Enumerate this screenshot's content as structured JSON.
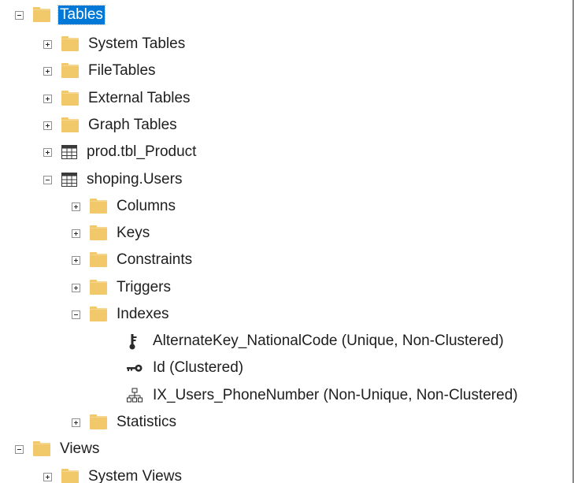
{
  "tree": {
    "top_partial_label": "",
    "nodes": [
      {
        "label": "Tables",
        "icon": "folder-icon",
        "state": "expanded",
        "selected": true
      },
      {
        "label": "System Tables",
        "icon": "folder-icon",
        "state": "collapsed"
      },
      {
        "label": "FileTables",
        "icon": "folder-icon",
        "state": "collapsed"
      },
      {
        "label": "External Tables",
        "icon": "folder-icon",
        "state": "collapsed"
      },
      {
        "label": "Graph Tables",
        "icon": "folder-icon",
        "state": "collapsed"
      },
      {
        "label": "prod.tbl_Product",
        "icon": "table-icon",
        "state": "collapsed"
      },
      {
        "label": "shoping.Users",
        "icon": "table-icon",
        "state": "expanded"
      },
      {
        "label": "Columns",
        "icon": "folder-icon",
        "state": "collapsed"
      },
      {
        "label": "Keys",
        "icon": "folder-icon",
        "state": "collapsed"
      },
      {
        "label": "Constraints",
        "icon": "folder-icon",
        "state": "collapsed"
      },
      {
        "label": "Triggers",
        "icon": "folder-icon",
        "state": "collapsed"
      },
      {
        "label": "Indexes",
        "icon": "folder-icon",
        "state": "expanded"
      },
      {
        "label": "AlternateKey_NationalCode (Unique, Non-Clustered)",
        "icon": "unique-index-icon",
        "state": "leaf"
      },
      {
        "label": "Id (Clustered)",
        "icon": "primary-key-icon",
        "state": "leaf"
      },
      {
        "label": "IX_Users_PhoneNumber (Non-Unique, Non-Clustered)",
        "icon": "nonclustered-index-icon",
        "state": "leaf"
      },
      {
        "label": "Statistics",
        "icon": "folder-icon",
        "state": "collapsed"
      },
      {
        "label": "Views",
        "icon": "folder-icon",
        "state": "expanded"
      },
      {
        "label": "System Views",
        "icon": "folder-icon",
        "state": "collapsed"
      }
    ]
  },
  "colors": {
    "selection": "#0078d7",
    "folder": "#f1c86a",
    "text": "#1e1e1e"
  }
}
